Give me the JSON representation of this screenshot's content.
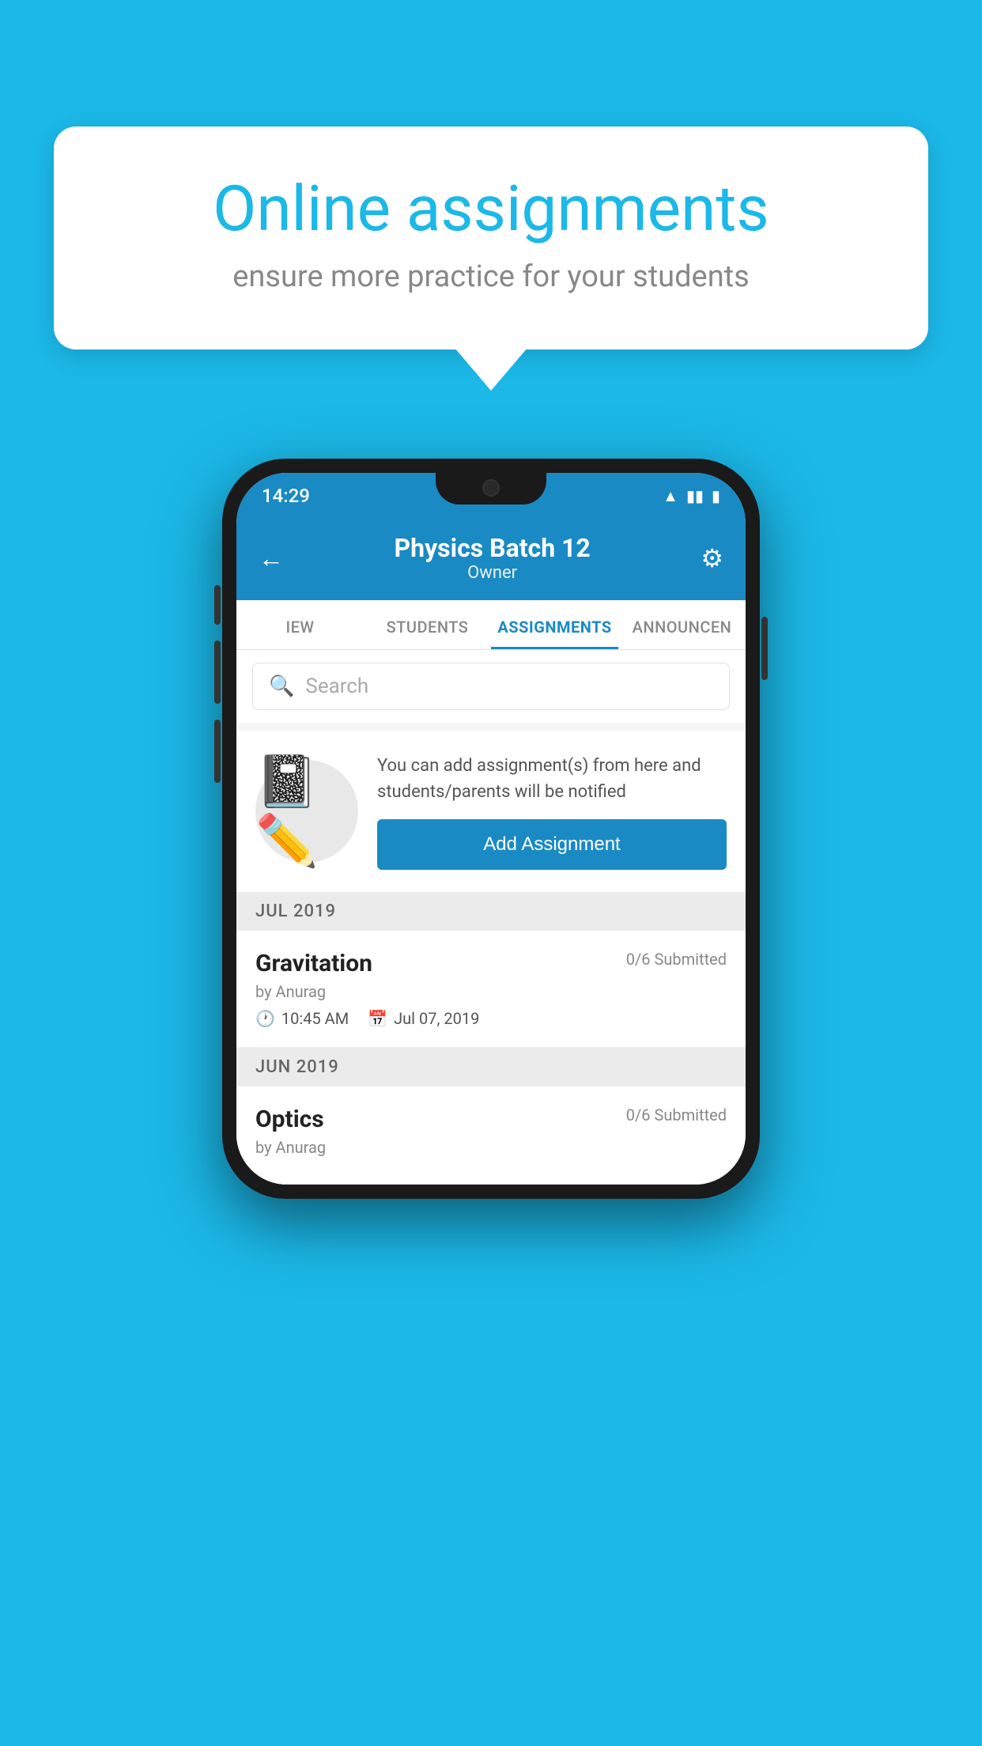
{
  "background_color": "#1BB8E8",
  "bubble": {
    "title": "Online assignments",
    "subtitle": "ensure more practice for your students"
  },
  "phone": {
    "status_bar": {
      "time": "14:29",
      "icons": [
        "wifi",
        "signal",
        "battery"
      ]
    },
    "header": {
      "title": "Physics Batch 12",
      "subtitle": "Owner",
      "back_label": "←",
      "gear_label": "⚙"
    },
    "tabs": [
      {
        "label": "IEW",
        "active": false
      },
      {
        "label": "STUDENTS",
        "active": false
      },
      {
        "label": "ASSIGNMENTS",
        "active": true
      },
      {
        "label": "ANNOUNCEN",
        "active": false
      }
    ],
    "search": {
      "placeholder": "Search"
    },
    "promo": {
      "description": "You can add assignment(s) from here and students/parents will be notified",
      "add_button_label": "Add Assignment"
    },
    "sections": [
      {
        "header": "JUL 2019",
        "assignments": [
          {
            "name": "Gravitation",
            "submitted": "0/6 Submitted",
            "by": "by Anurag",
            "time": "10:45 AM",
            "date": "Jul 07, 2019"
          }
        ]
      },
      {
        "header": "JUN 2019",
        "assignments": [
          {
            "name": "Optics",
            "submitted": "0/6 Submitted",
            "by": "by Anurag",
            "time": "",
            "date": ""
          }
        ]
      }
    ]
  }
}
